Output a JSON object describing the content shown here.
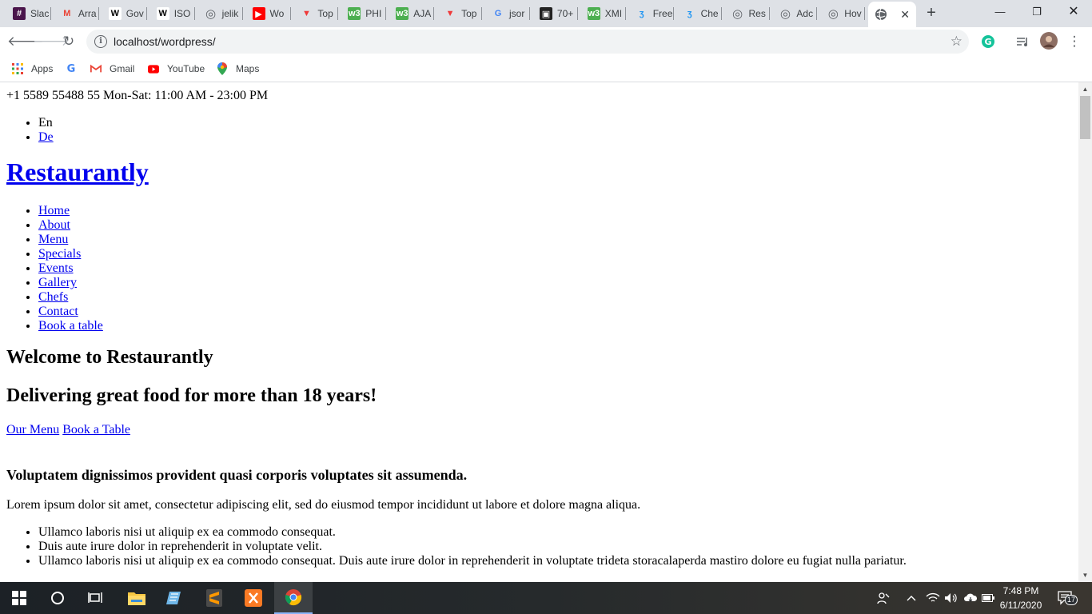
{
  "browser": {
    "tabs": [
      {
        "label": "Slac",
        "icon": "slack-icon",
        "color": "#4a154b"
      },
      {
        "label": "Arra",
        "icon": "gmail-icon",
        "color": "#ea4335"
      },
      {
        "label": "Gov",
        "icon": "wikipedia-icon",
        "color": "#ffffff"
      },
      {
        "label": "ISO",
        "icon": "wikipedia-icon",
        "color": "#ffffff"
      },
      {
        "label": "jelik",
        "icon": "globe-icon",
        "color": "#5f6368"
      },
      {
        "label": "Wo",
        "icon": "youtube-icon",
        "color": "#ff0000"
      },
      {
        "label": "Top",
        "icon": "vivaldi-icon",
        "color": "#ef3939"
      },
      {
        "label": "PHI",
        "icon": "w3schools-icon",
        "color": "#4caf50"
      },
      {
        "label": "AJA",
        "icon": "w3schools-icon",
        "color": "#4caf50"
      },
      {
        "label": "Top",
        "icon": "vivaldi-icon",
        "color": "#ef3939"
      },
      {
        "label": "jsor",
        "icon": "google-icon",
        "color": "#4285f4"
      },
      {
        "label": "70+",
        "icon": "box-icon",
        "color": "#222222"
      },
      {
        "label": "XMI",
        "icon": "w3schools-icon",
        "color": "#4caf50"
      },
      {
        "label": "Free",
        "icon": "bootstrap-icon",
        "color": "#2196f3"
      },
      {
        "label": "Che",
        "icon": "bootstrap-icon",
        "color": "#2196f3"
      },
      {
        "label": "Res",
        "icon": "globe-icon",
        "color": "#5f6368"
      },
      {
        "label": "Adc",
        "icon": "globe-icon",
        "color": "#5f6368"
      },
      {
        "label": "Hov",
        "icon": "globe-icon",
        "color": "#5f6368"
      }
    ],
    "active_tab_icon": "globe-icon",
    "url": "localhost/wordpress/",
    "bookmarks": [
      {
        "label": "Apps",
        "icon": "apps-grid-icon"
      },
      {
        "label": "",
        "icon": "google-icon"
      },
      {
        "label": "Gmail",
        "icon": "gmail-icon"
      },
      {
        "label": "YouTube",
        "icon": "youtube-icon"
      },
      {
        "label": "Maps",
        "icon": "maps-pin-icon"
      }
    ]
  },
  "page": {
    "topbar": "+1 5589 55488 55 Mon-Sat: 11:00 AM - 23:00 PM",
    "languages": [
      "En",
      "De"
    ],
    "site_title": "Restaurantly",
    "nav": [
      "Home",
      "About",
      "Menu",
      "Specials",
      "Events",
      "Gallery",
      "Chefs",
      "Contact",
      "Book a table"
    ],
    "hero_title": "Welcome to Restaurantly",
    "hero_subtitle": "Delivering great food for more than 18 years!",
    "cta_menu": "Our Menu",
    "cta_book": "Book a Table",
    "about_heading": "Voluptatem dignissimos provident quasi corporis voluptates sit assumenda.",
    "about_text": "Lorem ipsum dolor sit amet, consectetur adipiscing elit, sed do eiusmod tempor incididunt ut labore et dolore magna aliqua.",
    "about_list": [
      "Ullamco laboris nisi ut aliquip ex ea commodo consequat.",
      "Duis aute irure dolor in reprehenderit in voluptate velit.",
      "Ullamco laboris nisi ut aliquip ex ea commodo consequat. Duis aute irure dolor in reprehenderit in voluptate trideta storacalaperda mastiro dolore eu fugiat nulla pariatur."
    ]
  },
  "taskbar": {
    "time": "7:48 PM",
    "date": "6/11/2020",
    "notifications": "17"
  }
}
